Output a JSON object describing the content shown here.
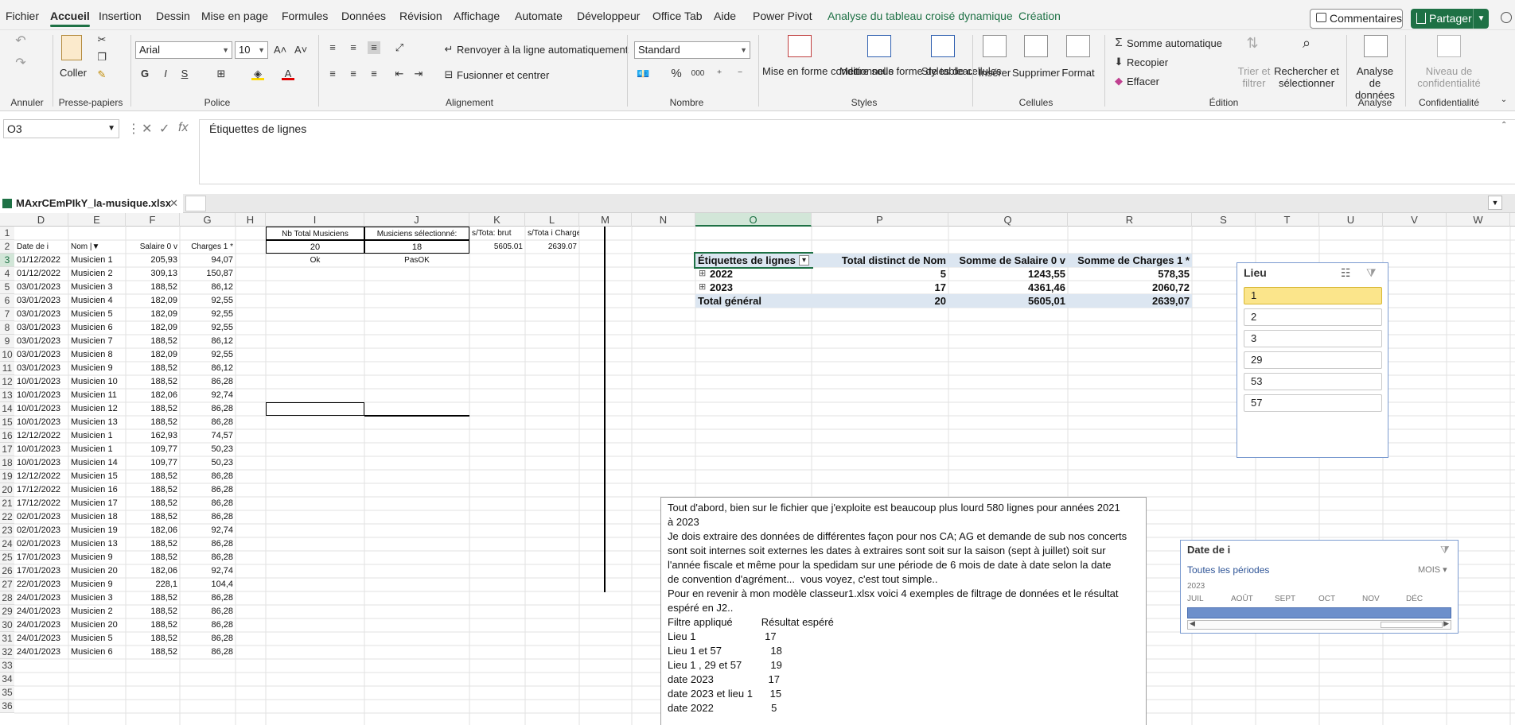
{
  "menu": {
    "tabs": [
      "Fichier",
      "Accueil",
      "Insertion",
      "Dessin",
      "Mise en page",
      "Formules",
      "Données",
      "Révision",
      "Affichage",
      "Automate",
      "Développeur",
      "Office Tab",
      "Aide",
      "Power Pivot",
      "Analyse du tableau croisé dynamique",
      "Création"
    ],
    "comments": "Commentaires",
    "share": "Partager"
  },
  "ribbon": {
    "undo_label": "Annuler",
    "clipboard": {
      "paste": "Coller",
      "label": "Presse-papiers"
    },
    "font": {
      "name": "Arial",
      "size": "10",
      "label": "Police",
      "bold": "G",
      "italic": "I",
      "underline": "S"
    },
    "alignment": {
      "wrap": "Renvoyer à la ligne automatiquement",
      "merge": "Fusionner et centrer",
      "label": "Alignement"
    },
    "number": {
      "format": "Standard",
      "percent": "%",
      "thousands": "000",
      "label": "Nombre"
    },
    "styles": {
      "conditional": "Mise en forme conditionnelle",
      "table": "Mettre sous forme de tableau",
      "cell": "Styles de cellules",
      "label": "Styles"
    },
    "cells": {
      "insert": "Insérer",
      "delete": "Supprimer",
      "format": "Format",
      "label": "Cellules"
    },
    "editing": {
      "autosum": "Somme automatique",
      "fill": "Recopier",
      "clear": "Effacer",
      "sort": "Trier et filtrer",
      "find": "Rechercher et sélectionner",
      "label": "Édition"
    },
    "analysis": {
      "analyze": "Analyse de données",
      "label": "Analyse"
    },
    "sensitivity": {
      "level": "Niveau de confidentialité",
      "label": "Confidentialité"
    }
  },
  "formula_bar": {
    "cell_ref": "O3",
    "content": "Étiquettes de lignes"
  },
  "workbook": {
    "tab_name": "MAxrCEmPIkY_la-musique.xlsx"
  },
  "columns": [
    "D",
    "E",
    "F",
    "G",
    "H",
    "I",
    "J",
    "K",
    "L",
    "M",
    "N",
    "O",
    "P",
    "Q",
    "R",
    "S",
    "T",
    "U",
    "V",
    "W"
  ],
  "rows": [
    "1",
    "2",
    "3",
    "4",
    "5",
    "6",
    "7",
    "8",
    "9",
    "10",
    "11",
    "12",
    "13",
    "14",
    "15",
    "16",
    "17",
    "18",
    "19",
    "20",
    "21",
    "22",
    "23",
    "24",
    "25",
    "26",
    "27",
    "28",
    "29",
    "30",
    "31",
    "32",
    "33",
    "34",
    "35",
    "36"
  ],
  "table": {
    "headers": [
      "Date de i",
      "Nom",
      "Salaire 0 v",
      "Charges 1 *"
    ],
    "rows": [
      [
        "01/12/2022",
        "Musicien 1",
        "205,93",
        "94,07"
      ],
      [
        "01/12/2022",
        "Musicien 2",
        "309,13",
        "150,87"
      ],
      [
        "03/01/2023",
        "Musicien 3",
        "188,52",
        "86,12"
      ],
      [
        "03/01/2023",
        "Musicien 4",
        "182,09",
        "92,55"
      ],
      [
        "03/01/2023",
        "Musicien 5",
        "182,09",
        "92,55"
      ],
      [
        "03/01/2023",
        "Musicien 6",
        "182,09",
        "92,55"
      ],
      [
        "03/01/2023",
        "Musicien 7",
        "188,52",
        "86,12"
      ],
      [
        "03/01/2023",
        "Musicien 8",
        "182,09",
        "92,55"
      ],
      [
        "03/01/2023",
        "Musicien 9",
        "188,52",
        "86,12"
      ],
      [
        "10/01/2023",
        "Musicien 10",
        "188,52",
        "86,28"
      ],
      [
        "10/01/2023",
        "Musicien 11",
        "182,06",
        "92,74"
      ],
      [
        "10/01/2023",
        "Musicien 12",
        "188,52",
        "86,28"
      ],
      [
        "10/01/2023",
        "Musicien 13",
        "188,52",
        "86,28"
      ],
      [
        "12/12/2022",
        "Musicien 1",
        "162,93",
        "74,57"
      ],
      [
        "10/01/2023",
        "Musicien 1",
        "109,77",
        "50,23"
      ],
      [
        "10/01/2023",
        "Musicien 14",
        "109,77",
        "50,23"
      ],
      [
        "12/12/2022",
        "Musicien 15",
        "188,52",
        "86,28"
      ],
      [
        "17/12/2022",
        "Musicien 16",
        "188,52",
        "86,28"
      ],
      [
        "17/12/2022",
        "Musicien 17",
        "188,52",
        "86,28"
      ],
      [
        "02/01/2023",
        "Musicien 18",
        "188,52",
        "86,28"
      ],
      [
        "02/01/2023",
        "Musicien 19",
        "182,06",
        "92,74"
      ],
      [
        "02/01/2023",
        "Musicien 13",
        "188,52",
        "86,28"
      ],
      [
        "17/01/2023",
        "Musicien 9",
        "188,52",
        "86,28"
      ],
      [
        "17/01/2023",
        "Musicien 20",
        "182,06",
        "92,74"
      ],
      [
        "22/01/2023",
        "Musicien 9",
        "228,1",
        "104,4"
      ],
      [
        "24/01/2023",
        "Musicien 3",
        "188,52",
        "86,28"
      ],
      [
        "24/01/2023",
        "Musicien 2",
        "188,52",
        "86,28"
      ],
      [
        "24/01/2023",
        "Musicien 20",
        "188,52",
        "86,28"
      ],
      [
        "24/01/2023",
        "Musicien 5",
        "188,52",
        "86,28"
      ],
      [
        "24/01/2023",
        "Musicien 6",
        "188,52",
        "86,28"
      ]
    ]
  },
  "summary": {
    "nb_total_label": "Nb Total Musiciens",
    "nb_selected_label": "Musiciens sélectionné:",
    "total_brut_label": "s/Tota: brut",
    "total_charges_label": "s/Tota i Charges",
    "nb_total": "20",
    "nb_selected": "18",
    "total_brut": "5605.01",
    "total_charges": "2639.07",
    "ok": "Ok",
    "pasok": "PasOK"
  },
  "pivot": {
    "headers": [
      "Étiquettes de lignes",
      "Total distinct de Nom",
      "Somme de Salaire 0 v",
      "Somme de Charges 1 *"
    ],
    "rows": [
      [
        "2022",
        "5",
        "1243,55",
        "578,35"
      ],
      [
        "2023",
        "17",
        "4361,46",
        "2060,72"
      ]
    ],
    "total": [
      "Total général",
      "20",
      "5605,01",
      "2639,07"
    ]
  },
  "slicer_lieu": {
    "title": "Lieu",
    "items": [
      "1",
      "2",
      "3",
      "29",
      "53",
      "57"
    ],
    "selected_index": 0
  },
  "timeline": {
    "title": "Date de i",
    "period_label": "Toutes les périodes",
    "level": "MOIS",
    "year": "2023",
    "months": [
      "JUIL",
      "AOÛT",
      "SEPT",
      "OCT",
      "NOV",
      "DÉC"
    ]
  },
  "textbox": {
    "lines": [
      "Tout d'abord, bien sur le fichier que j'exploite est beaucoup plus lourd 580 lignes pour années 2021",
      "à 2023",
      "Je dois extraire des données de différentes façon pour nos CA; AG et demande de sub nos concerts",
      "sont soit internes soit externes les dates à extraires sont soit sur la saison (sept à juillet) soit sur",
      "l'année fiscale et même pour la spedidam sur une période de 6 mois de date à date selon la date",
      "de convention d'agrément...  vous voyez, c'est tout simple..",
      "Pour en revenir à mon modèle classeur1.xlsx voici 4 exemples de filtrage de données et le résultat",
      "espéré en J2..",
      "Filtre appliqué          Résultat espéré",
      "Lieu 1                        17",
      "Lieu 1 et 57                 18",
      "Lieu 1 , 29 et 57          19",
      "date 2023                   17",
      "date 2023 et lieu 1      15",
      "date 2022                    5"
    ]
  },
  "colors": {
    "accent": "#1e7145",
    "pivot_header": "#dce6f1",
    "slicer_selected": "#fbe58b",
    "timeline_bar": "#6d8fcb"
  }
}
